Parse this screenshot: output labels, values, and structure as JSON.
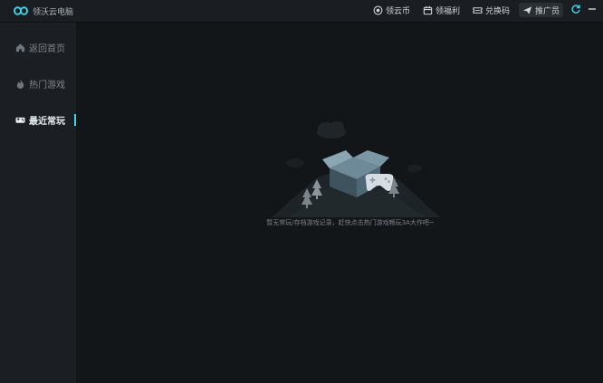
{
  "app": {
    "title": "领沃云电脑"
  },
  "toolbar": {
    "coins_label": "领云币",
    "benefits_label": "领福利",
    "redeem_label": "兑换码",
    "promoter_label": "推广员"
  },
  "sidebar": {
    "items": [
      {
        "label": "返回首页",
        "icon": "home-icon"
      },
      {
        "label": "热门游戏",
        "icon": "flame-icon"
      },
      {
        "label": "最近常玩",
        "icon": "gamepad-icon"
      }
    ],
    "active_index": 2
  },
  "empty_state": {
    "message": "暂无常玩/存档游戏记录，赶快点击热门游戏畅玩3A大作吧~"
  },
  "colors": {
    "accent": "#3fd3e7",
    "background": "#121619",
    "sidebar": "#1b1f23"
  }
}
